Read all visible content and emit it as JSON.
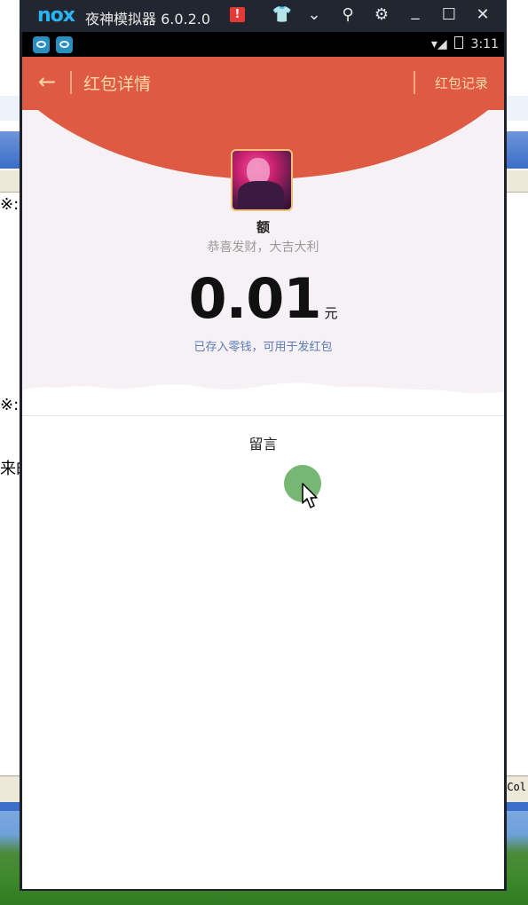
{
  "emulator": {
    "logo": "nox",
    "name": "夜神模拟器 6.0.2.0",
    "warning_badge": "!",
    "title_buttons": [
      {
        "icon": "shirt-icon",
        "glyph": "👕"
      },
      {
        "icon": "chevron-down-icon",
        "glyph": "⌄"
      },
      {
        "icon": "pin-icon",
        "glyph": "⚲"
      },
      {
        "icon": "gear-icon",
        "glyph": "⚙"
      },
      {
        "icon": "minimize-icon",
        "glyph": "_"
      },
      {
        "icon": "maximize-icon",
        "glyph": "☐"
      },
      {
        "icon": "close-icon",
        "glyph": "✕"
      }
    ]
  },
  "status_bar": {
    "apps": [
      "app-icon-1",
      "app-icon-2"
    ],
    "signal": "▾◢",
    "time": "3:11"
  },
  "header": {
    "back_glyph": "←",
    "title": "红包详情",
    "record_link": "红包记录"
  },
  "packet": {
    "sender_name": "额",
    "greeting": "恭喜发财，大吉大利",
    "amount": "0.01",
    "unit": "元",
    "saved_note": "已存入零钱，可用于发红包"
  },
  "message_section": {
    "title": "留言"
  },
  "background_window": {
    "fragments": [
      "※:",
      "※:",
      "来的"
    ],
    "statusbar_text": "Col"
  },
  "colors": {
    "header_red": "#de5a43",
    "header_text": "#ffd9a6",
    "link_blue": "#5a7bb5",
    "touch_dot": "#6fb36b"
  }
}
